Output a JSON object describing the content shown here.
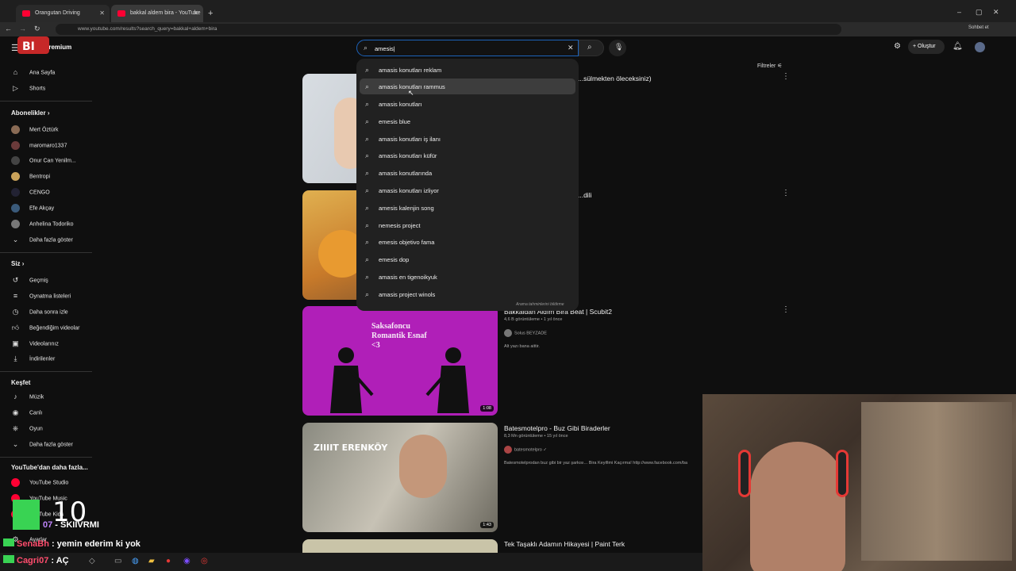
{
  "browser": {
    "tabs": [
      {
        "title": "Orangutan Driving"
      },
      {
        "title": "bakkal aldem bira - YouTube"
      }
    ],
    "url": "www.youtube.com/results?search_query=bakkal+aldem+bira",
    "profile_label": "Sohbet et"
  },
  "header": {
    "logo_text": "Premium",
    "search_value": "amesis|",
    "create_label": "Oluştur",
    "filters_label": "Filtreler"
  },
  "sidebar": {
    "main": [
      {
        "label": "Ana Sayfa",
        "icon": "home-icon"
      },
      {
        "label": "Shorts",
        "icon": "shorts-icon"
      }
    ],
    "subscriptions_title": "Abonelikler",
    "subscriptions": [
      {
        "label": "Mert Öztürk",
        "color": "#8a6b55"
      },
      {
        "label": "maromaro1337",
        "color": "#6a3a3a"
      },
      {
        "label": "Onur Can Yenilm...",
        "color": "#444444"
      },
      {
        "label": "Bentropi",
        "color": "#c9a25a"
      },
      {
        "label": "CENGO",
        "color": "#222233"
      },
      {
        "label": "Efe Akçay",
        "color": "#3a5a7a"
      },
      {
        "label": "Anhelina Todoriko",
        "color": "#777777"
      }
    ],
    "show_more": "Daha fazla göster",
    "you_title": "Siz",
    "you": [
      {
        "label": "Geçmiş",
        "icon": "history-icon"
      },
      {
        "label": "Oynatma listeleri",
        "icon": "playlist-icon"
      },
      {
        "label": "Daha sonra izle",
        "icon": "clock-icon"
      },
      {
        "label": "Beğendiğim videolar",
        "icon": "like-icon"
      },
      {
        "label": "Videolarınız",
        "icon": "video-icon"
      },
      {
        "label": "İndirilenler",
        "icon": "download-icon"
      }
    ],
    "explore_title": "Keşfet",
    "explore": [
      {
        "label": "Müzik",
        "icon": "music-icon"
      },
      {
        "label": "Canlı",
        "icon": "live-icon"
      },
      {
        "label": "Oyun",
        "icon": "gaming-icon"
      },
      {
        "label": "Daha fazla göster",
        "icon": "chevron-down-icon"
      }
    ],
    "more_title": "YouTube'dan daha fazla...",
    "more": [
      {
        "label": "YouTube Studio"
      },
      {
        "label": "YouTube Music"
      },
      {
        "label": "YouTube Kids"
      }
    ],
    "settings_label": "Ayarlar"
  },
  "suggestions": [
    "amasis konutları reklam",
    "amasis konutları rammus",
    "amasis konutları",
    "emesis blue",
    "amasis konutları iş ilanı",
    "amasis konutları küfür",
    "amasis konutlarında",
    "amasis konutları izliyor",
    "amesis kalenjin song",
    "nemesis project",
    "emesis objetivo fama",
    "emesis dop",
    "amasis en tigenoikyuk",
    "amasis project winols"
  ],
  "suggest_report": "Arama tahminlerini bildirme",
  "videos": [
    {
      "title": "...sülmekten öleceksiniz)",
      "meta": "",
      "channel": "",
      "desc": "",
      "duration": ""
    },
    {
      "title": "...dili",
      "meta": "",
      "channel": "",
      "desc": "",
      "duration": ""
    },
    {
      "title": "Bakkaldan Aldım Bira Beat | Scubit2",
      "meta": "4,6 B görüntüleme • 1 yıl önce",
      "channel": "Solus BEYZADE",
      "desc": "Alt yazı bana aittir.",
      "duration": "1:08",
      "thumb_text": "Saksafoncu Romantik Esnaf <3"
    },
    {
      "title": "Batesmotelpro - Buz Gibi Biraderler",
      "meta": "8,3 Mn görüntüleme • 15 yıl önce",
      "channel": "batesmotelpro",
      "desc": "Batesmotelprodan buz gibi bir yaz şarkısı... Bira Keyifimi Kaçırma! http://www.facebook.com/ba",
      "duration": "1:43",
      "thumb_text": "ZIIIIT ERENKÖY"
    },
    {
      "title": "Tek Taşaklı Adamın Hikayesi | Paint Terk",
      "meta": "",
      "channel": "",
      "desc": "",
      "duration": ""
    }
  ],
  "overlay": {
    "counter": "10",
    "chat": [
      {
        "user": "07",
        "text": " - SKIIVRMI"
      },
      {
        "user": "SenaBh",
        "text": " : yemin ederim ki yok"
      },
      {
        "user": "Cagri07",
        "text": " : AÇ"
      }
    ]
  },
  "colors": {
    "accent": "#1c62b9",
    "youtube_red": "#ff0033",
    "thumb_purple": "#b01fb8"
  }
}
